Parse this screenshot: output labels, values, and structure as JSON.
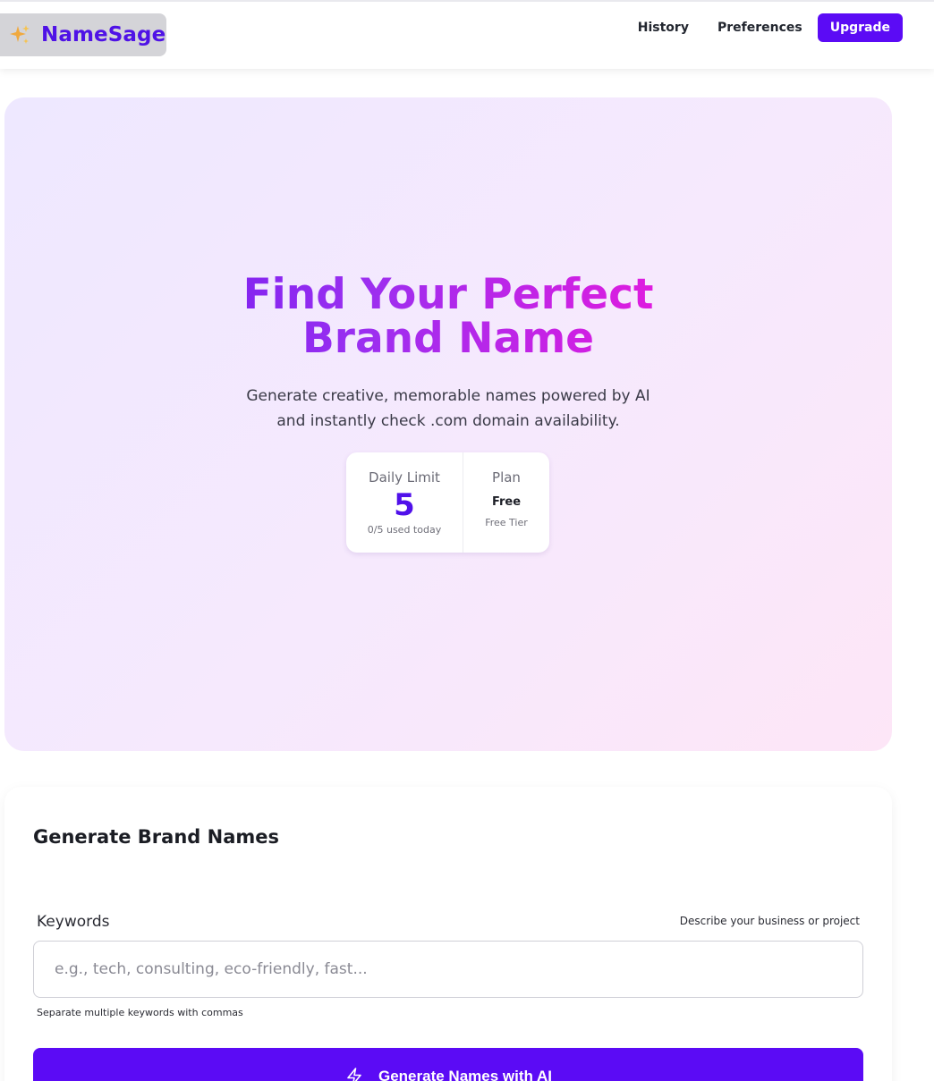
{
  "header": {
    "brand_name": "NameSage",
    "brand_icon": "sparkles-icon",
    "nav": {
      "history": "History",
      "preferences": "Preferences",
      "upgrade": "Upgrade"
    }
  },
  "hero": {
    "title_line1": "Find Your Perfect",
    "title_line2": "Brand Name",
    "subtitle_line1": "Generate creative, memorable names powered by AI",
    "subtitle_line2": "and instantly check .com domain availability.",
    "stats": {
      "daily_limit_label": "Daily Limit",
      "daily_limit_value": "5",
      "daily_limit_note": "0/5 used today",
      "plan_label": "Plan",
      "plan_value": "Free",
      "plan_note": "Free Tier"
    }
  },
  "generator": {
    "title": "Generate Brand Names",
    "keywords_label": "Keywords",
    "keywords_hint": "Describe your business or project",
    "keywords_value": "",
    "keywords_placeholder": "e.g., tech, consulting, eco-friendly, fast...",
    "keywords_help": "Separate multiple keywords with commas",
    "generate_button": "Generate Names with AI",
    "generate_icon": "lightning-bolt-icon"
  },
  "colors": {
    "brand_accent": "#5b0bf5",
    "gradient_start": "#5a10f0",
    "gradient_end": "#f21ad6"
  }
}
